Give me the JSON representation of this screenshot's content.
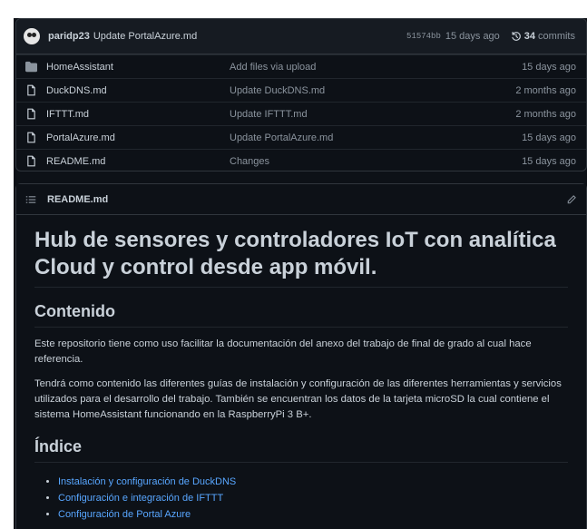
{
  "commit": {
    "author": "paridp23",
    "message": "Update PortalAzure.md",
    "hash": "51574bb",
    "time": "15 days ago",
    "count": "34",
    "count_label": "commits"
  },
  "files": [
    {
      "icon": "folder-icon",
      "name": "HomeAssistant",
      "commit": "Add files via upload",
      "age": "15 days ago"
    },
    {
      "icon": "file-icon",
      "name": "DuckDNS.md",
      "commit": "Update DuckDNS.md",
      "age": "2 months ago"
    },
    {
      "icon": "file-icon",
      "name": "IFTTT.md",
      "commit": "Update IFTTT.md",
      "age": "2 months ago"
    },
    {
      "icon": "file-icon",
      "name": "PortalAzure.md",
      "commit": "Update PortalAzure.md",
      "age": "15 days ago"
    },
    {
      "icon": "file-icon",
      "name": "README.md",
      "commit": "Changes",
      "age": "15 days ago"
    }
  ],
  "readme": {
    "filename": "README.md",
    "title": "Hub de sensores y controladores IoT con analítica Cloud y control desde app móvil.",
    "section1": "Contenido",
    "para1": "Este repositorio tiene como uso facilitar la documentación del anexo del trabajo de final de grado al cual hace referencia.",
    "para2": "Tendrá como contenido las diferentes guías de instalación y configuración de las diferentes herramientas y servicios utilizados para el desarrollo del trabajo. También se encuentran los datos de la tarjeta microSD la cual contiene el sistema HomeAssistant funcionando en la RaspberryPi 3 B+.",
    "section2": "Índice",
    "links": [
      "Instalación y configuración de DuckDNS",
      "Configuración e integración de IFTTT",
      "Configuración de Portal Azure"
    ]
  },
  "colors": {
    "background": "#0d1117",
    "link": "#58a6ff",
    "border": "#30363d"
  }
}
